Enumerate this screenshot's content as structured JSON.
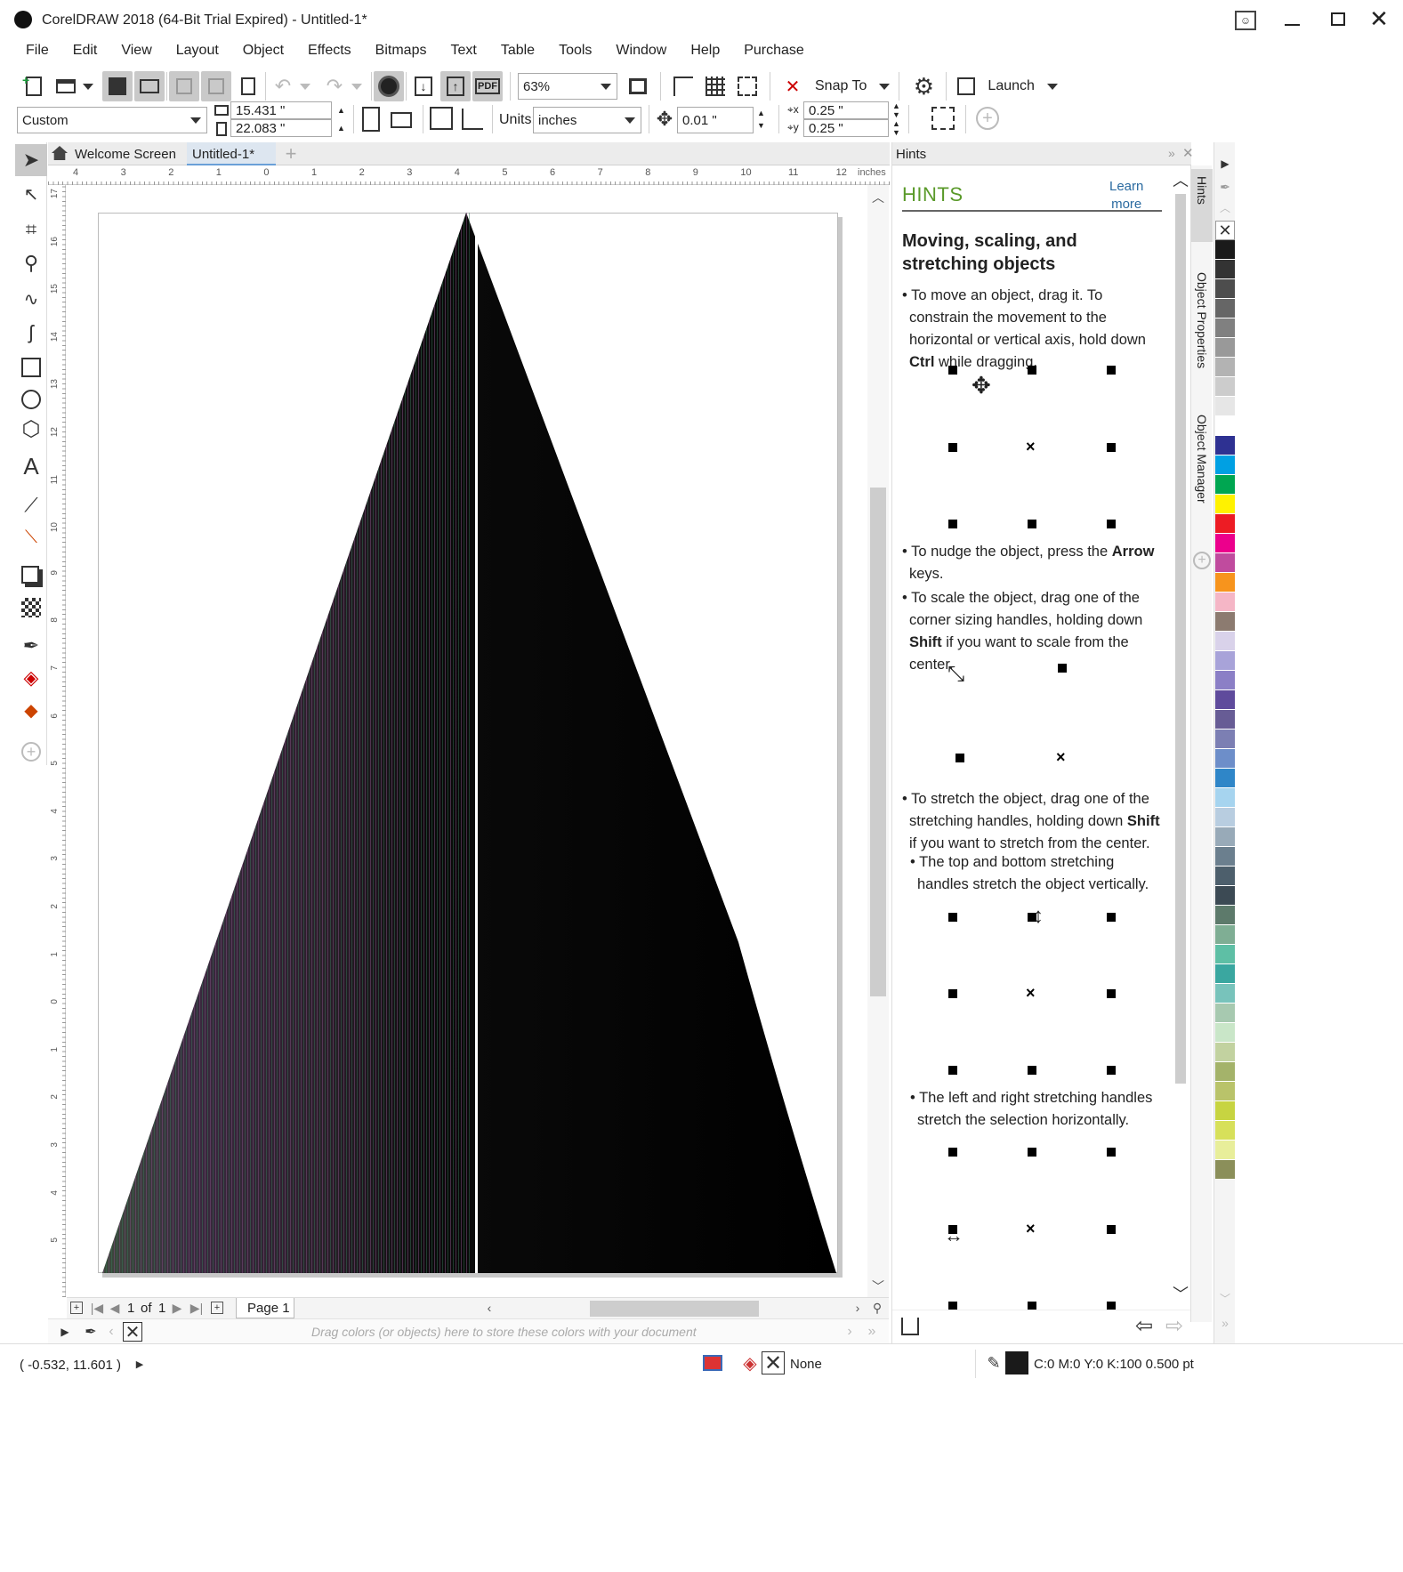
{
  "app": {
    "title": "CorelDRAW 2018 (64-Bit Trial Expired) - Untitled-1*"
  },
  "menu": [
    "File",
    "Edit",
    "View",
    "Layout",
    "Object",
    "Effects",
    "Bitmaps",
    "Text",
    "Table",
    "Tools",
    "Window",
    "Help",
    "Purchase"
  ],
  "toolbar": {
    "zoom": "63%",
    "snap_to": "Snap To",
    "launch": "Launch",
    "pdf_label": "PDF"
  },
  "property_bar": {
    "page_size": "Custom",
    "width": "15.431 \"",
    "height": "22.083 \"",
    "units_label": "Units:",
    "units_value": "inches",
    "nudge": "0.01 \"",
    "dup_x": "0.25 \"",
    "dup_y": "0.25 \""
  },
  "tabs": {
    "welcome": "Welcome Screen",
    "doc": "Untitled-1*"
  },
  "ruler": {
    "h_ticks": [
      "4",
      "3",
      "2",
      "1",
      "0",
      "1",
      "2",
      "3",
      "4",
      "5",
      "6",
      "7",
      "8",
      "9",
      "10",
      "11",
      "12"
    ],
    "v_ticks": [
      "17",
      "16",
      "15",
      "14",
      "13",
      "12",
      "11",
      "10",
      "9",
      "8",
      "7",
      "6",
      "5",
      "4",
      "3",
      "2",
      "1",
      "0",
      "1",
      "2",
      "3",
      "4",
      "5"
    ],
    "unit": "inches"
  },
  "page_nav": {
    "current": "1",
    "of_label": "of",
    "total": "1",
    "page_tab": "Page 1"
  },
  "palette_hint": "Drag colors (or objects) here to store these colors with your document",
  "status": {
    "coords": "( -0.532, 11.601 )",
    "fill_label": "None",
    "outline": "C:0 M:0 Y:0 K:100  0.500 pt"
  },
  "hints_panel": {
    "title": "Hints",
    "heading": "HINTS",
    "learn_more_1": "Learn",
    "learn_more_2": "more",
    "topic": "Moving, scaling, and stretching objects",
    "p1_a": "To move an object, drag it. To constrain the movement to the horizontal or vertical axis, hold down ",
    "p1_b": "Ctrl",
    "p1_c": " while dragging.",
    "p2_a": "To nudge the object, press the ",
    "p2_b": "Arrow",
    "p2_c": " keys.",
    "p3_a": "To scale the object, drag one of the corner sizing handles, holding down ",
    "p3_b": "Shift",
    "p3_c": " if you want to scale from the center.",
    "p4_a": "To stretch the object, drag one of the stretching handles, holding down ",
    "p4_b": "Shift",
    "p4_c": " if you want to stretch from the center.",
    "p5": "The top and bottom stretching handles stretch the object vertically.",
    "p6": "The left and right stretching handles stretch the selection horizontally."
  },
  "docker_tabs": [
    "Hints",
    "Object Properties",
    "Object Manager"
  ],
  "palette_colors": [
    "#1a1a1a",
    "#333333",
    "#4d4d4d",
    "#666666",
    "#808080",
    "#999999",
    "#b3b3b3",
    "#cccccc",
    "#e6e6e6",
    "#ffffff",
    "#2e3192",
    "#00a0e3",
    "#00a651",
    "#fff200",
    "#ed1c24",
    "#ec008c",
    "#c04b9e",
    "#f7941d",
    "#f5b6c6",
    "#8c7b70",
    "#d9d2ea",
    "#a8a3d9",
    "#8b7fc6",
    "#5f4b9c",
    "#675c95",
    "#7c7fb3",
    "#6d8ec9",
    "#2f86c8",
    "#a6d4ef",
    "#b8cde0",
    "#98aab8",
    "#6b7f8e",
    "#4d5f6c",
    "#3c4a54",
    "#5d7a6b",
    "#7fae94",
    "#5ebfa5",
    "#3aa7a0",
    "#78c3bb",
    "#a7c9b0",
    "#c9e6c8",
    "#c2d2a0",
    "#a4b36a",
    "#b9c36a",
    "#c7d441",
    "#d7e05a",
    "#e8ee9a",
    "#8b8f5a"
  ]
}
